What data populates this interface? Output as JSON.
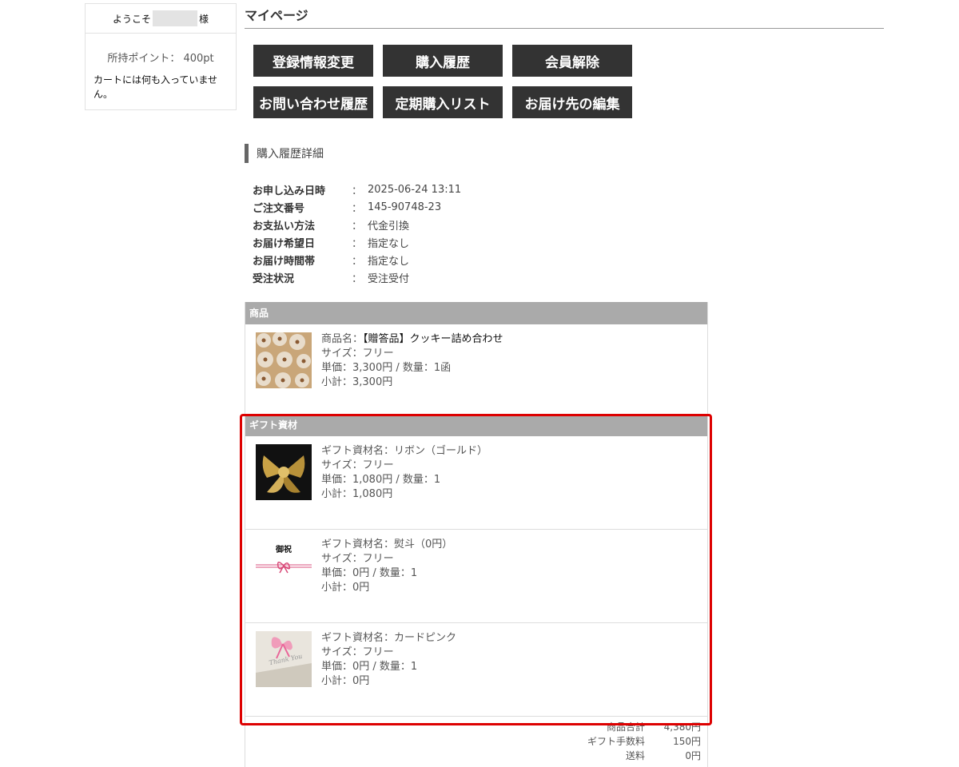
{
  "sidebar": {
    "welcome_prefix": "ようこそ",
    "welcome_suffix": "様",
    "points": "所持ポイント： 400pt",
    "cart_empty": "カートには何も入っていません。"
  },
  "mypage": {
    "title": "マイページ",
    "buttons": [
      "登録情報変更",
      "購入履歴",
      "会員解除",
      "お問い合わせ履歴",
      "定期購入リスト",
      "お届け先の編集"
    ]
  },
  "detail": {
    "heading": "購入履歴詳細",
    "rows": [
      {
        "label": "お申し込み日時",
        "value": "2025-06-24 13:11"
      },
      {
        "label": "ご注文番号",
        "value": "145-90748-23"
      },
      {
        "label": "お支払い方法",
        "value": "代金引換"
      },
      {
        "label": "お届け希望日",
        "value": "指定なし"
      },
      {
        "label": "お届け時間帯",
        "value": "指定なし"
      },
      {
        "label": "受注状況",
        "value": "受注受付"
      }
    ],
    "colon": "："
  },
  "products": {
    "header": "商品",
    "item": {
      "name_label": "商品名：",
      "name": "【贈答品】クッキー詰め合わせ",
      "size": "サイズ：フリー",
      "price": "単価：3,300円 / 数量：1函",
      "subtotal": "小計：3,300円"
    }
  },
  "gifts": {
    "header": "ギフト資材",
    "items": [
      {
        "name": "ギフト資材名：リボン（ゴールド）",
        "size": "サイズ：フリー",
        "price": "単価：1,080円 / 数量：1",
        "subtotal": "小計：1,080円"
      },
      {
        "name": "ギフト資材名：熨斗（0円）",
        "size": "サイズ：フリー",
        "price": "単価：0円 / 数量：1",
        "subtotal": "小計：0円"
      },
      {
        "name": "ギフト資材名：カードピンク",
        "size": "サイズ：フリー",
        "price": "単価：0円 / 数量：1",
        "subtotal": "小計：0円"
      }
    ],
    "noshi_text": "御祝",
    "card_text": "Thank You"
  },
  "totals": [
    {
      "label": "商品合計",
      "value": "4,380円"
    },
    {
      "label": "ギフト手数料",
      "value": "150円"
    },
    {
      "label": "送料",
      "value": "0円"
    }
  ],
  "colors": {
    "button_bg": "#333333",
    "table_head": "#aaaaaa",
    "highlight": "#dd0000"
  }
}
